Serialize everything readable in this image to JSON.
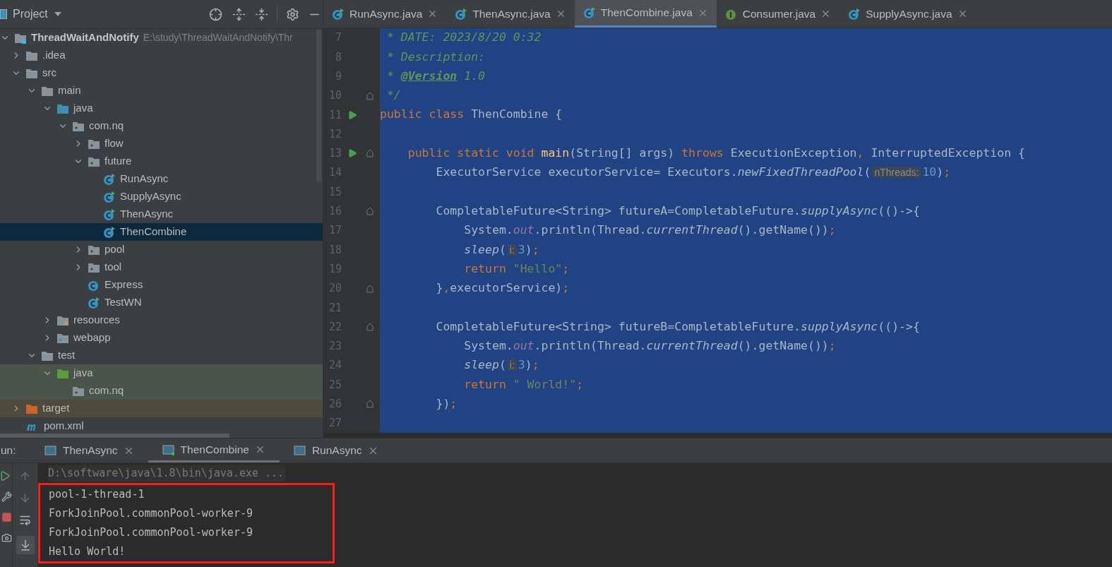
{
  "project_panel": {
    "title": "Project",
    "tree": [
      {
        "label": "ThreadWaitAndNotify",
        "path": "E:\\study\\ThreadWaitAndNotify\\Thr",
        "kind": "module",
        "expanded": true,
        "selected": false,
        "children": [
          {
            "label": ".idea",
            "kind": "folder",
            "expanded": false,
            "selected": false
          },
          {
            "label": "src",
            "kind": "folder",
            "expanded": true,
            "selected": false,
            "children": [
              {
                "label": "main",
                "kind": "folder",
                "expanded": true,
                "selected": false,
                "children": [
                  {
                    "label": "java",
                    "kind": "source",
                    "expanded": true,
                    "selected": false,
                    "children": [
                      {
                        "label": "com.nq",
                        "kind": "package",
                        "expanded": true,
                        "selected": false,
                        "children": [
                          {
                            "label": "flow",
                            "kind": "package",
                            "expanded": false,
                            "selected": false
                          },
                          {
                            "label": "future",
                            "kind": "package",
                            "expanded": true,
                            "selected": false,
                            "children": [
                              {
                                "label": "RunAsync",
                                "kind": "runclass",
                                "selected": false
                              },
                              {
                                "label": "SupplyAsync",
                                "kind": "runclass",
                                "selected": false
                              },
                              {
                                "label": "ThenAsync",
                                "kind": "runclass",
                                "selected": false
                              },
                              {
                                "label": "ThenCombine",
                                "kind": "runclass",
                                "selected": true
                              }
                            ]
                          },
                          {
                            "label": "pool",
                            "kind": "package",
                            "expanded": false,
                            "selected": false
                          },
                          {
                            "label": "tool",
                            "kind": "package",
                            "expanded": false,
                            "selected": false
                          },
                          {
                            "label": "Express",
                            "kind": "class",
                            "selected": false
                          },
                          {
                            "label": "TestWN",
                            "kind": "runclass",
                            "selected": false
                          }
                        ]
                      }
                    ]
                  },
                  {
                    "label": "resources",
                    "kind": "resources",
                    "expanded": false,
                    "selected": false
                  },
                  {
                    "label": "webapp",
                    "kind": "webapp",
                    "expanded": false,
                    "selected": false
                  }
                ]
              },
              {
                "label": "test",
                "kind": "folder",
                "expanded": true,
                "selected": false,
                "children": [
                  {
                    "label": "java",
                    "kind": "test",
                    "expanded": true,
                    "selected": false,
                    "children": [
                      {
                        "label": "com.nq",
                        "kind": "package",
                        "selected": false
                      }
                    ]
                  }
                ]
              }
            ]
          },
          {
            "label": "target",
            "kind": "excluded",
            "expanded": false,
            "selected": false
          },
          {
            "label": "pom.xml",
            "kind": "maven",
            "selected": false
          }
        ]
      }
    ]
  },
  "editor_tabs": [
    {
      "label": "RunAsync.java",
      "kind": "runclass",
      "selected": false
    },
    {
      "label": "ThenAsync.java",
      "kind": "runclass",
      "selected": false
    },
    {
      "label": "ThenCombine.java",
      "kind": "runclass",
      "selected": true
    },
    {
      "label": "Consumer.java",
      "kind": "interface",
      "selected": false
    },
    {
      "label": "SupplyAsync.java",
      "kind": "runclass",
      "selected": false
    }
  ],
  "code": [
    {
      "number": "7",
      "run": false,
      "fold": false,
      "tokens": [
        {
          "t": " * DATE: 2023/8/20 0:32",
          "kind": "comment"
        }
      ]
    },
    {
      "number": "8",
      "run": false,
      "fold": false,
      "tokens": [
        {
          "t": " * Description:",
          "kind": "comment"
        }
      ]
    },
    {
      "number": "9",
      "run": false,
      "fold": false,
      "tokens": [
        {
          "t": " * ",
          "kind": "comment"
        },
        {
          "t": "@Version",
          "kind": "doctag"
        },
        {
          "t": " 1.0",
          "kind": "comment"
        }
      ]
    },
    {
      "number": "10",
      "run": false,
      "fold": true,
      "tokens": [
        {
          "t": " */",
          "kind": "comment"
        }
      ]
    },
    {
      "number": "11",
      "run": true,
      "fold": false,
      "tokens": [
        {
          "t": "public class ",
          "kind": "keyword"
        },
        {
          "t": "ThenCombine {",
          "kind": "plain"
        }
      ]
    },
    {
      "number": "12",
      "run": false,
      "fold": false
    },
    {
      "number": "13",
      "run": true,
      "fold": true,
      "tokens": [
        {
          "t": "    public static void ",
          "kind": "keyword"
        },
        {
          "t": "main",
          "kind": "method"
        },
        {
          "t": "(String[] args) ",
          "kind": "plain"
        },
        {
          "t": "throws ",
          "kind": "keyword"
        },
        {
          "t": "ExecutionException",
          "kind": "plain"
        },
        {
          "t": ", ",
          "kind": "keyword"
        },
        {
          "t": "InterruptedException {",
          "kind": "plain"
        }
      ]
    },
    {
      "number": "14",
      "run": false,
      "fold": false,
      "tokens": [
        {
          "t": "        ExecutorService executorService= Executors.",
          "kind": "plain"
        },
        {
          "t": "newFixedThreadPool",
          "kind": "static"
        },
        {
          "t": "(",
          "kind": "plain"
        },
        {
          "t": "nThreads:",
          "kind": "hint"
        },
        {
          "t": "10",
          "kind": "number"
        },
        {
          "t": ")",
          "kind": "plain"
        },
        {
          "t": ";",
          "kind": "keyword"
        }
      ]
    },
    {
      "number": "15",
      "run": false,
      "fold": false
    },
    {
      "number": "16",
      "run": false,
      "fold": true,
      "tokens": [
        {
          "t": "        CompletableFuture<String> futureA=CompletableFuture.",
          "kind": "plain"
        },
        {
          "t": "supplyAsync",
          "kind": "static"
        },
        {
          "t": "(()->{",
          "kind": "plain"
        }
      ]
    },
    {
      "number": "17",
      "run": false,
      "fold": false,
      "tokens": [
        {
          "t": "            System.",
          "kind": "plain"
        },
        {
          "t": "out",
          "kind": "field"
        },
        {
          "t": ".println(Thread.",
          "kind": "plain"
        },
        {
          "t": "currentThread",
          "kind": "static"
        },
        {
          "t": "().getName())",
          "kind": "plain"
        },
        {
          "t": ";",
          "kind": "keyword"
        }
      ]
    },
    {
      "number": "18",
      "run": false,
      "fold": false,
      "tokens": [
        {
          "t": "            sleep",
          "kind": "static"
        },
        {
          "t": "(",
          "kind": "plain"
        },
        {
          "t": "i:",
          "kind": "hint"
        },
        {
          "t": "3",
          "kind": "number"
        },
        {
          "t": ")",
          "kind": "plain"
        },
        {
          "t": ";",
          "kind": "keyword"
        }
      ]
    },
    {
      "number": "19",
      "run": false,
      "fold": false,
      "tokens": [
        {
          "t": "            return ",
          "kind": "keyword"
        },
        {
          "t": "\"Hello\"",
          "kind": "string"
        },
        {
          "t": ";",
          "kind": "keyword"
        }
      ]
    },
    {
      "number": "20",
      "run": false,
      "fold": true,
      "tokens": [
        {
          "t": "        }",
          "kind": "plain"
        },
        {
          "t": ",",
          "kind": "keyword"
        },
        {
          "t": "executorService)",
          "kind": "plain"
        },
        {
          "t": ";",
          "kind": "keyword"
        }
      ]
    },
    {
      "number": "21",
      "run": false,
      "fold": false
    },
    {
      "number": "22",
      "run": false,
      "fold": true,
      "tokens": [
        {
          "t": "        CompletableFuture<String> futureB=CompletableFuture.",
          "kind": "plain"
        },
        {
          "t": "supplyAsync",
          "kind": "static"
        },
        {
          "t": "(()->{",
          "kind": "plain"
        }
      ]
    },
    {
      "number": "23",
      "run": false,
      "fold": false,
      "tokens": [
        {
          "t": "            System.",
          "kind": "plain"
        },
        {
          "t": "out",
          "kind": "field"
        },
        {
          "t": ".println(Thread.",
          "kind": "plain"
        },
        {
          "t": "currentThread",
          "kind": "static"
        },
        {
          "t": "().getName())",
          "kind": "plain"
        },
        {
          "t": ";",
          "kind": "keyword"
        }
      ]
    },
    {
      "number": "24",
      "run": false,
      "fold": false,
      "tokens": [
        {
          "t": "            sleep",
          "kind": "static"
        },
        {
          "t": "(",
          "kind": "plain"
        },
        {
          "t": "i:",
          "kind": "hint"
        },
        {
          "t": "3",
          "kind": "number"
        },
        {
          "t": ")",
          "kind": "plain"
        },
        {
          "t": ";",
          "kind": "keyword"
        }
      ]
    },
    {
      "number": "25",
      "run": false,
      "fold": false,
      "tokens": [
        {
          "t": "            return ",
          "kind": "keyword"
        },
        {
          "t": "\" World!\"",
          "kind": "string"
        },
        {
          "t": ";",
          "kind": "keyword"
        }
      ]
    },
    {
      "number": "26",
      "run": false,
      "fold": true,
      "tokens": [
        {
          "t": "        })",
          "kind": "plain"
        },
        {
          "t": ";",
          "kind": "keyword"
        }
      ]
    },
    {
      "number": "27",
      "run": false,
      "fold": false
    }
  ],
  "run_panel": {
    "label": "un:",
    "tabs": [
      {
        "label": "ThenAsync",
        "selected": false,
        "running": false
      },
      {
        "label": "ThenCombine",
        "selected": true,
        "running": true
      },
      {
        "label": "RunAsync",
        "selected": false,
        "running": false
      }
    ],
    "command": "D:\\software\\java\\1.8\\bin\\java.exe ...",
    "output": [
      "pool-1-thread-1",
      "ForkJoinPool.commonPool-worker-9",
      "ForkJoinPool.commonPool-worker-9",
      "Hello World!"
    ],
    "output_highlighted": true
  }
}
